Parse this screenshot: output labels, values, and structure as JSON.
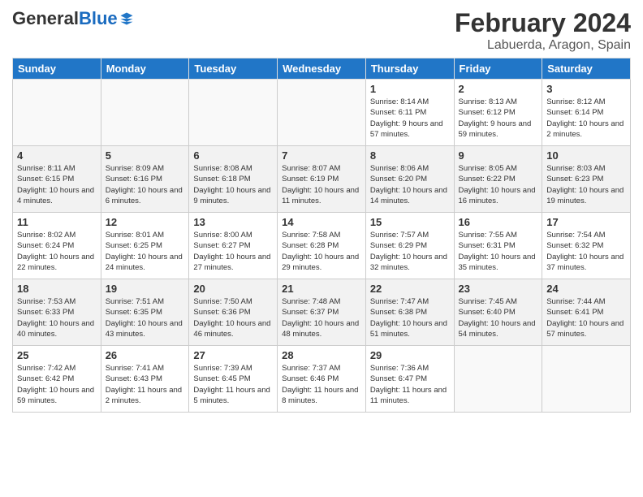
{
  "header": {
    "logo_general": "General",
    "logo_blue": "Blue",
    "title": "February 2024",
    "subtitle": "Labuerda, Aragon, Spain"
  },
  "weekdays": [
    "Sunday",
    "Monday",
    "Tuesday",
    "Wednesday",
    "Thursday",
    "Friday",
    "Saturday"
  ],
  "weeks": [
    [
      {
        "day": "",
        "info": ""
      },
      {
        "day": "",
        "info": ""
      },
      {
        "day": "",
        "info": ""
      },
      {
        "day": "",
        "info": ""
      },
      {
        "day": "1",
        "info": "Sunrise: 8:14 AM\nSunset: 6:11 PM\nDaylight: 9 hours\nand 57 minutes."
      },
      {
        "day": "2",
        "info": "Sunrise: 8:13 AM\nSunset: 6:12 PM\nDaylight: 9 hours\nand 59 minutes."
      },
      {
        "day": "3",
        "info": "Sunrise: 8:12 AM\nSunset: 6:14 PM\nDaylight: 10 hours\nand 2 minutes."
      }
    ],
    [
      {
        "day": "4",
        "info": "Sunrise: 8:11 AM\nSunset: 6:15 PM\nDaylight: 10 hours\nand 4 minutes."
      },
      {
        "day": "5",
        "info": "Sunrise: 8:09 AM\nSunset: 6:16 PM\nDaylight: 10 hours\nand 6 minutes."
      },
      {
        "day": "6",
        "info": "Sunrise: 8:08 AM\nSunset: 6:18 PM\nDaylight: 10 hours\nand 9 minutes."
      },
      {
        "day": "7",
        "info": "Sunrise: 8:07 AM\nSunset: 6:19 PM\nDaylight: 10 hours\nand 11 minutes."
      },
      {
        "day": "8",
        "info": "Sunrise: 8:06 AM\nSunset: 6:20 PM\nDaylight: 10 hours\nand 14 minutes."
      },
      {
        "day": "9",
        "info": "Sunrise: 8:05 AM\nSunset: 6:22 PM\nDaylight: 10 hours\nand 16 minutes."
      },
      {
        "day": "10",
        "info": "Sunrise: 8:03 AM\nSunset: 6:23 PM\nDaylight: 10 hours\nand 19 minutes."
      }
    ],
    [
      {
        "day": "11",
        "info": "Sunrise: 8:02 AM\nSunset: 6:24 PM\nDaylight: 10 hours\nand 22 minutes."
      },
      {
        "day": "12",
        "info": "Sunrise: 8:01 AM\nSunset: 6:25 PM\nDaylight: 10 hours\nand 24 minutes."
      },
      {
        "day": "13",
        "info": "Sunrise: 8:00 AM\nSunset: 6:27 PM\nDaylight: 10 hours\nand 27 minutes."
      },
      {
        "day": "14",
        "info": "Sunrise: 7:58 AM\nSunset: 6:28 PM\nDaylight: 10 hours\nand 29 minutes."
      },
      {
        "day": "15",
        "info": "Sunrise: 7:57 AM\nSunset: 6:29 PM\nDaylight: 10 hours\nand 32 minutes."
      },
      {
        "day": "16",
        "info": "Sunrise: 7:55 AM\nSunset: 6:31 PM\nDaylight: 10 hours\nand 35 minutes."
      },
      {
        "day": "17",
        "info": "Sunrise: 7:54 AM\nSunset: 6:32 PM\nDaylight: 10 hours\nand 37 minutes."
      }
    ],
    [
      {
        "day": "18",
        "info": "Sunrise: 7:53 AM\nSunset: 6:33 PM\nDaylight: 10 hours\nand 40 minutes."
      },
      {
        "day": "19",
        "info": "Sunrise: 7:51 AM\nSunset: 6:35 PM\nDaylight: 10 hours\nand 43 minutes."
      },
      {
        "day": "20",
        "info": "Sunrise: 7:50 AM\nSunset: 6:36 PM\nDaylight: 10 hours\nand 46 minutes."
      },
      {
        "day": "21",
        "info": "Sunrise: 7:48 AM\nSunset: 6:37 PM\nDaylight: 10 hours\nand 48 minutes."
      },
      {
        "day": "22",
        "info": "Sunrise: 7:47 AM\nSunset: 6:38 PM\nDaylight: 10 hours\nand 51 minutes."
      },
      {
        "day": "23",
        "info": "Sunrise: 7:45 AM\nSunset: 6:40 PM\nDaylight: 10 hours\nand 54 minutes."
      },
      {
        "day": "24",
        "info": "Sunrise: 7:44 AM\nSunset: 6:41 PM\nDaylight: 10 hours\nand 57 minutes."
      }
    ],
    [
      {
        "day": "25",
        "info": "Sunrise: 7:42 AM\nSunset: 6:42 PM\nDaylight: 10 hours\nand 59 minutes."
      },
      {
        "day": "26",
        "info": "Sunrise: 7:41 AM\nSunset: 6:43 PM\nDaylight: 11 hours\nand 2 minutes."
      },
      {
        "day": "27",
        "info": "Sunrise: 7:39 AM\nSunset: 6:45 PM\nDaylight: 11 hours\nand 5 minutes."
      },
      {
        "day": "28",
        "info": "Sunrise: 7:37 AM\nSunset: 6:46 PM\nDaylight: 11 hours\nand 8 minutes."
      },
      {
        "day": "29",
        "info": "Sunrise: 7:36 AM\nSunset: 6:47 PM\nDaylight: 11 hours\nand 11 minutes."
      },
      {
        "day": "",
        "info": ""
      },
      {
        "day": "",
        "info": ""
      }
    ]
  ]
}
